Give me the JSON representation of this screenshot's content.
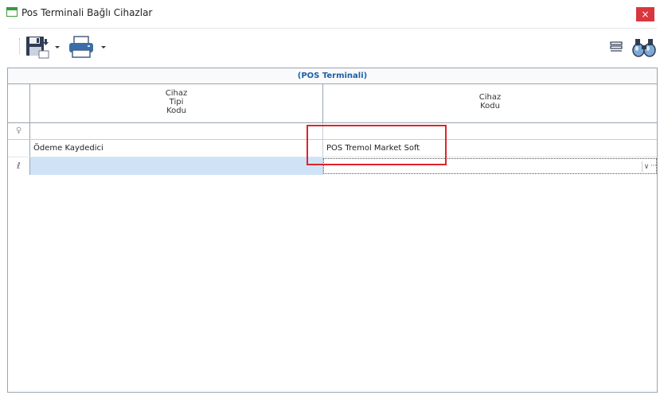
{
  "window": {
    "title": "Pos Terminali Bağlı Cihazlar",
    "close_label": "×"
  },
  "toolbar": {
    "icons": [
      "save-icon",
      "print-icon",
      "column-chooser-icon",
      "binoculars-icon"
    ]
  },
  "grid": {
    "group_header": "(POS Terminali)",
    "columns": [
      {
        "lines": [
          "Cihaz",
          "Tipi",
          "Kodu"
        ]
      },
      {
        "lines": [
          "Cihaz",
          "Kodu"
        ]
      }
    ],
    "filter_indicator": "♀",
    "rows": [
      {
        "cihaz_tipi_kodu": "Ödeme Kaydedici",
        "cihaz_kodu": "POS Tremol Market Soft"
      }
    ],
    "new_row": {
      "indicator": "ℓ",
      "dropdown_glyph": "∨",
      "ellipsis_glyph": "···"
    }
  },
  "colors": {
    "accent": "#1a5fa8",
    "close": "#d9363e",
    "highlight": "#e0232a",
    "selection": "#cfe3f6"
  }
}
